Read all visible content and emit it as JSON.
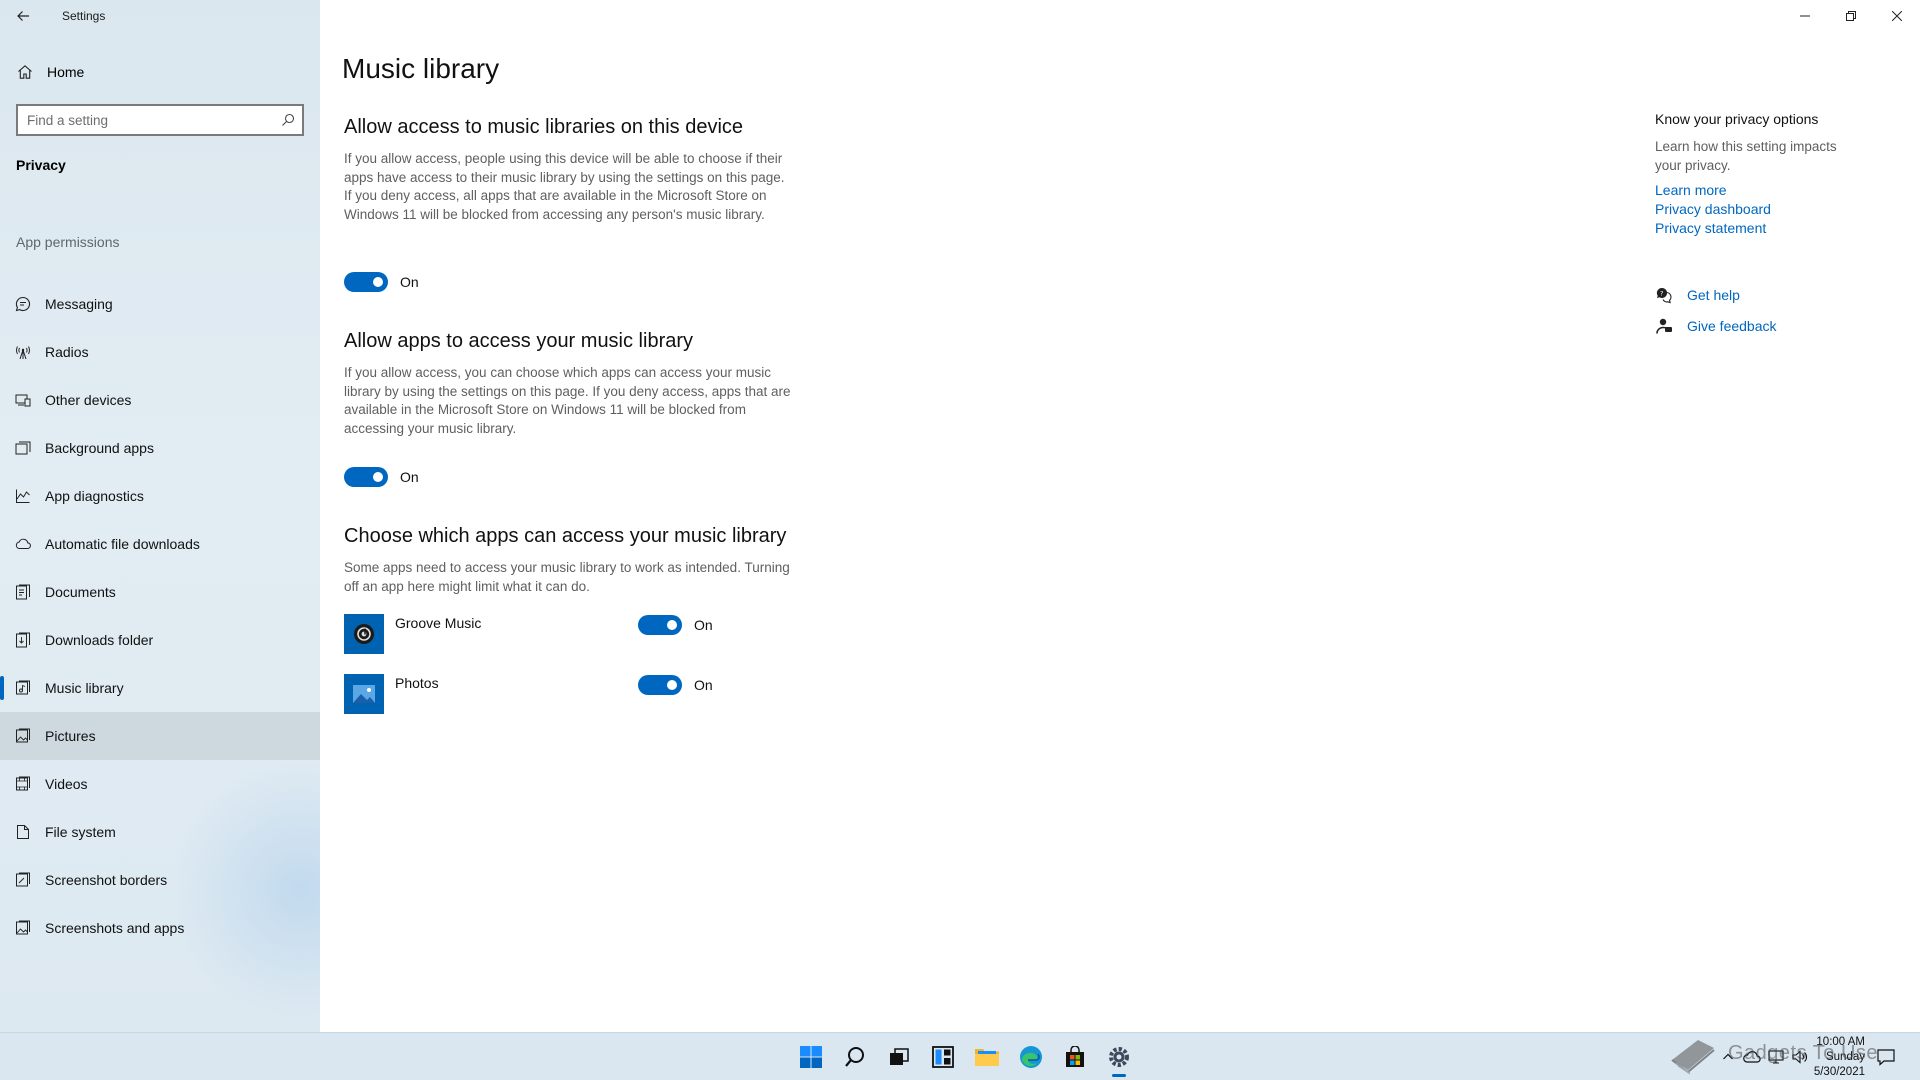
{
  "window": {
    "title": "Settings"
  },
  "sidebar": {
    "home_label": "Home",
    "search_placeholder": "Find a setting",
    "section_title": "Privacy",
    "group_title": "App permissions",
    "items": [
      {
        "label": "Messaging",
        "icon": "chat-icon"
      },
      {
        "label": "Radios",
        "icon": "antenna-icon"
      },
      {
        "label": "Other devices",
        "icon": "devices-icon"
      },
      {
        "label": "Background apps",
        "icon": "background-apps-icon"
      },
      {
        "label": "App diagnostics",
        "icon": "chart-icon"
      },
      {
        "label": "Automatic file downloads",
        "icon": "cloud-icon"
      },
      {
        "label": "Documents",
        "icon": "document-icon"
      },
      {
        "label": "Downloads folder",
        "icon": "download-folder-icon"
      },
      {
        "label": "Music library",
        "icon": "music-icon"
      },
      {
        "label": "Pictures",
        "icon": "picture-icon"
      },
      {
        "label": "Videos",
        "icon": "video-icon"
      },
      {
        "label": "File system",
        "icon": "file-icon"
      },
      {
        "label": "Screenshot borders",
        "icon": "screenshot-border-icon"
      },
      {
        "label": "Screenshots and apps",
        "icon": "screenshot-icon"
      }
    ],
    "selected": "Music library",
    "hovered": "Pictures"
  },
  "main": {
    "page_title": "Music library",
    "section1": {
      "heading": "Allow access to music libraries on this device",
      "description": "If you allow access, people using this device will be able to choose if their apps have access to their music library by using the settings on this page. If you deny access, all apps that are available in the Microsoft Store on Windows 11 will be blocked from accessing any person's music library.",
      "toggle_label": "On"
    },
    "section2": {
      "heading": "Allow apps to access your music library",
      "description": "If you allow access, you can choose which apps can access your music library by using the settings on this page. If you deny access, apps that are available in the Microsoft Store on Windows 11 will be blocked from accessing your music library.",
      "toggle_label": "On"
    },
    "section3": {
      "heading": "Choose which apps can access your music library",
      "description": "Some apps need to access your music library to work as intended. Turning off an app here might limit what it can do.",
      "apps": [
        {
          "name": "Groove Music",
          "toggle_label": "On"
        },
        {
          "name": "Photos",
          "toggle_label": "On"
        }
      ]
    }
  },
  "aside": {
    "title": "Know your privacy options",
    "description": "Learn how this setting impacts your privacy.",
    "links": [
      "Learn more",
      "Privacy dashboard",
      "Privacy statement"
    ],
    "get_help": "Get help",
    "give_feedback": "Give feedback"
  },
  "taskbar": {
    "time": "10:00 AM",
    "day": "Sunday",
    "date": "5/30/2021",
    "watermark": "Gadgets To Use"
  },
  "colors": {
    "accent": "#0067c0",
    "sidebar_bg": "#dde9f1",
    "taskbar_bg": "#dae6f0"
  }
}
